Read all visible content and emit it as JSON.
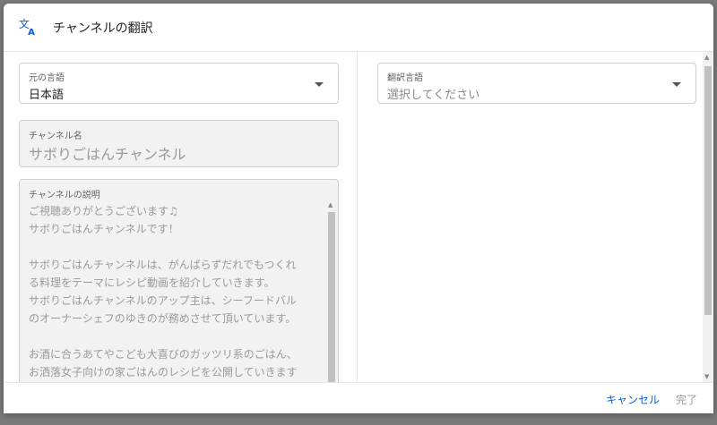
{
  "dialog": {
    "title": "チャンネルの翻訳",
    "icon": "translate-icon"
  },
  "source_language": {
    "label": "元の言語",
    "value": "日本語"
  },
  "channel_name": {
    "label": "チャンネル名",
    "value": "サボりごはんチャンネル"
  },
  "channel_description": {
    "label": "チャンネルの説明",
    "lines": [
      "ご視聴ありがとうございます♫",
      "サボりごはんチャンネルです！",
      "",
      "サボりごはんチャンネルは、がんばらずだれでもつくれ",
      "る料理をテーマにレシピ動画を紹介していきます。",
      "サボりごはんチャンネルのアップ主は、シーフードバル",
      "のオーナーシェフのゆきのが務めさせて頂いています。",
      "",
      "お酒に合うあてやこども大喜びのガッツリ系のごはん、",
      "お洒落女子向けの家ごはんのレシピを公開していきます",
      "♫"
    ]
  },
  "target_language": {
    "label": "翻訳言語",
    "placeholder": "選択してください"
  },
  "footer": {
    "cancel_label": "キャンセル",
    "done_label": "完了"
  },
  "colors": {
    "accent": "#065fd4",
    "icon": "#065fd4"
  }
}
